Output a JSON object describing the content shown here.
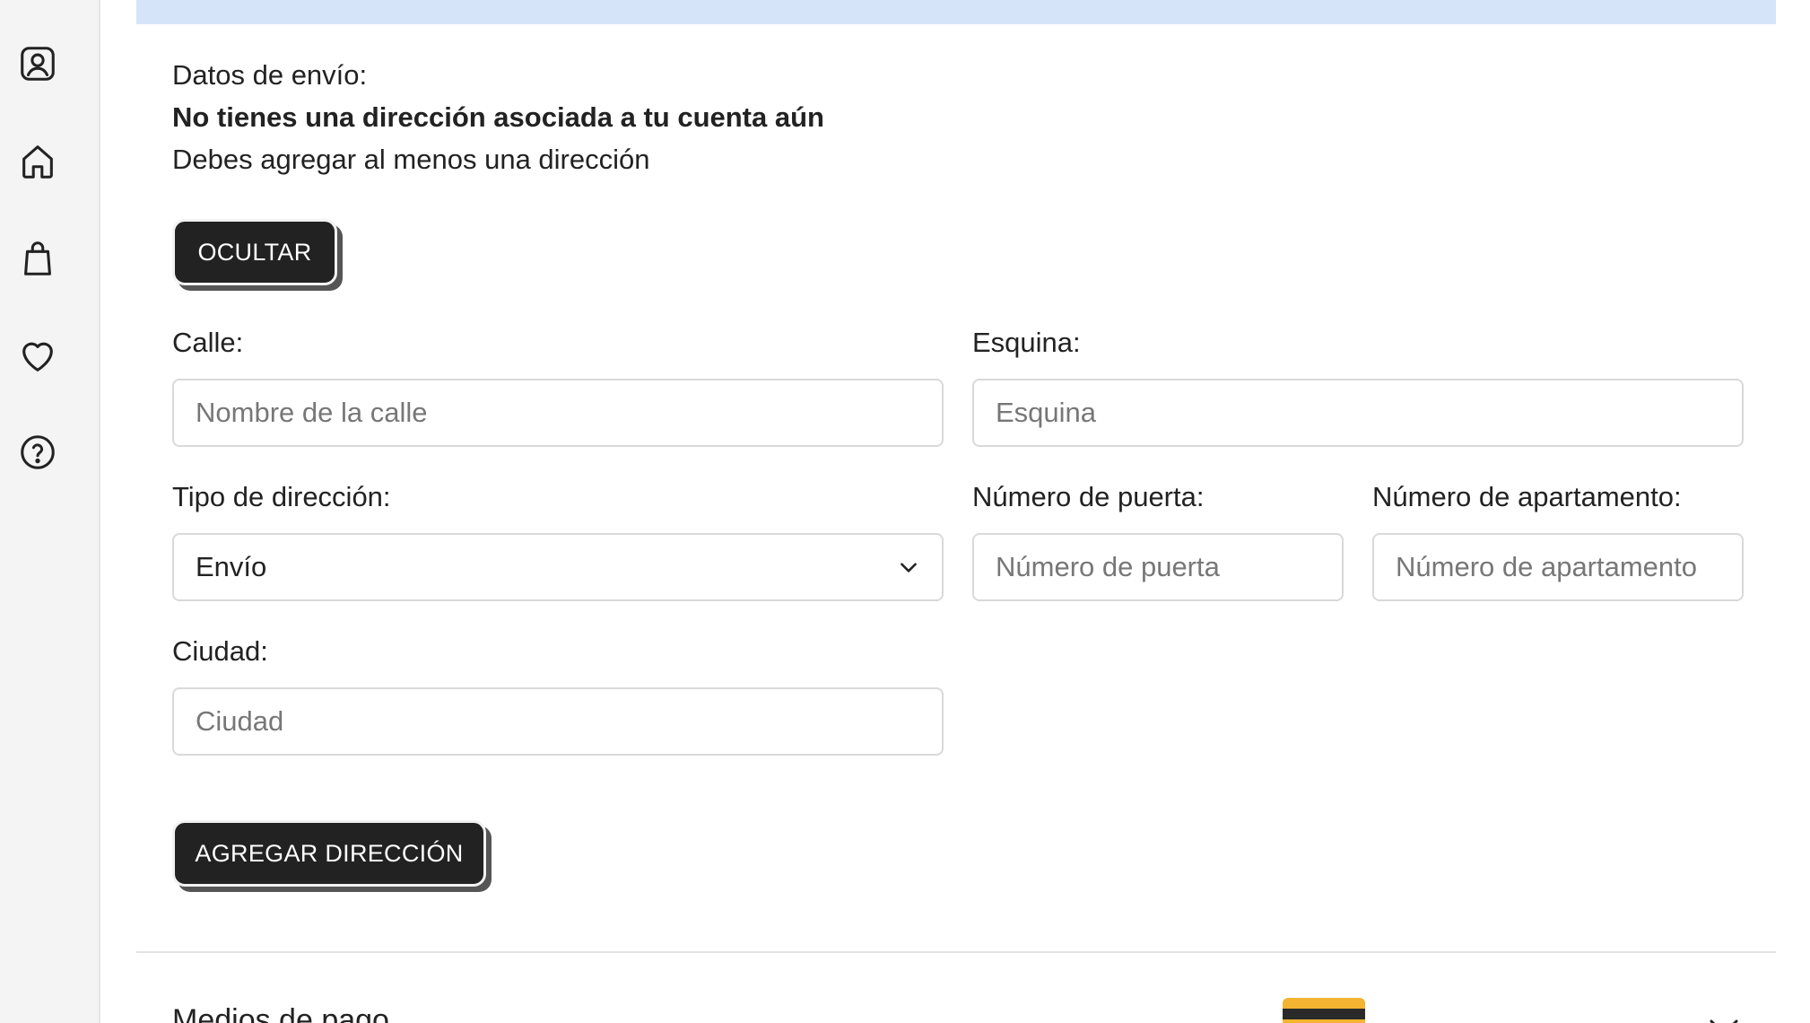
{
  "sidebar": {
    "items": [
      {
        "icon": "user-icon"
      },
      {
        "icon": "home-icon"
      },
      {
        "icon": "bag-icon"
      },
      {
        "icon": "heart-icon"
      },
      {
        "icon": "help-icon"
      }
    ]
  },
  "shipping": {
    "title": "Datos de envío:",
    "no_address": "No tienes una dirección asociada a tu cuenta aún",
    "hint": "Debes agregar al menos una dirección",
    "hide_button": "OCULTAR"
  },
  "form": {
    "street": {
      "label": "Calle:",
      "placeholder": "Nombre de la calle",
      "value": ""
    },
    "corner": {
      "label": "Esquina:",
      "placeholder": "Esquina",
      "value": ""
    },
    "address_type": {
      "label": "Tipo de dirección:",
      "value": "Envío"
    },
    "door_number": {
      "label": "Número de puerta:",
      "placeholder": "Número de puerta",
      "value": ""
    },
    "apartment_number": {
      "label": "Número de apartamento:",
      "placeholder": "Número de apartamento",
      "value": ""
    },
    "city": {
      "label": "Ciudad:",
      "placeholder": "Ciudad",
      "value": ""
    },
    "submit_button": "AGREGAR DIRECCIÓN"
  },
  "payment": {
    "title": "Medios de pago"
  },
  "colors": {
    "banner": "#d6e4f9",
    "button": "#222222",
    "card_accent": "#f2b431"
  }
}
